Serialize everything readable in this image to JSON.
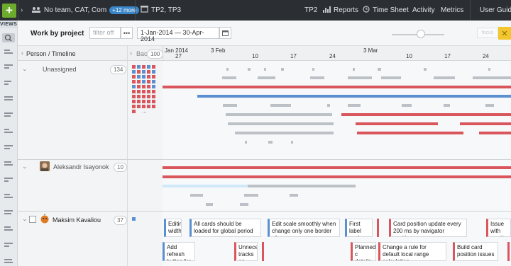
{
  "topbar": {
    "team_text": "No team, CAT, Com",
    "more_badge": "+12 more",
    "projects_text": "TP2, TP3",
    "nav_tp2": "TP2",
    "nav_reports": "Reports",
    "nav_timesheet": "Time Sheet",
    "nav_activity": "Activity",
    "nav_metrics": "Metrics",
    "user_guide": "User Guide"
  },
  "leftbar": {
    "views_label": "VIEWS"
  },
  "toolbar": {
    "title": "Work by project",
    "filter_placeholder": "filter off",
    "more_label": "•••",
    "date_range": "1-Jan-2014 — 30-Apr-2014",
    "focus_label": "focus",
    "close_label": "✕"
  },
  "header": {
    "person_timeline": "Person / Timeline",
    "backlog_label": "Bac",
    "backlog_count": "100",
    "months": [
      "Jan 2014",
      "3 Feb",
      "3 Mar"
    ],
    "days": [
      "27",
      "10",
      "17",
      "24",
      "10",
      "17",
      "24"
    ]
  },
  "groups": [
    {
      "name": "Unassigned",
      "count": "134"
    },
    {
      "name": "Aleksandr Isayonok",
      "count": "10"
    },
    {
      "name": "Maksim Kavaliou",
      "count": "37"
    }
  ],
  "cards": [
    {
      "text": "Editin width"
    },
    {
      "text": "All cards should be loaded for global period"
    },
    {
      "text": "Edit scale smoothly when change only one border of"
    },
    {
      "text": "First label scale shor"
    },
    {
      "text": "Card position update every 200 ms by navigator position"
    },
    {
      "text": "Issue with position"
    },
    {
      "text": "Add refresh button for"
    },
    {
      "text": "Unneces tracks an"
    },
    {
      "text": "Planned c details are"
    },
    {
      "text": "Change a rule for default local range calculation"
    },
    {
      "text": "Build card position issues"
    }
  ],
  "colors": {
    "accent_green": "#6cab2c",
    "bug_red": "#d9565c",
    "feature_blue": "#5a8fd0",
    "badge_blue": "#3a86c8",
    "focus_yellow": "#f3c62e"
  }
}
